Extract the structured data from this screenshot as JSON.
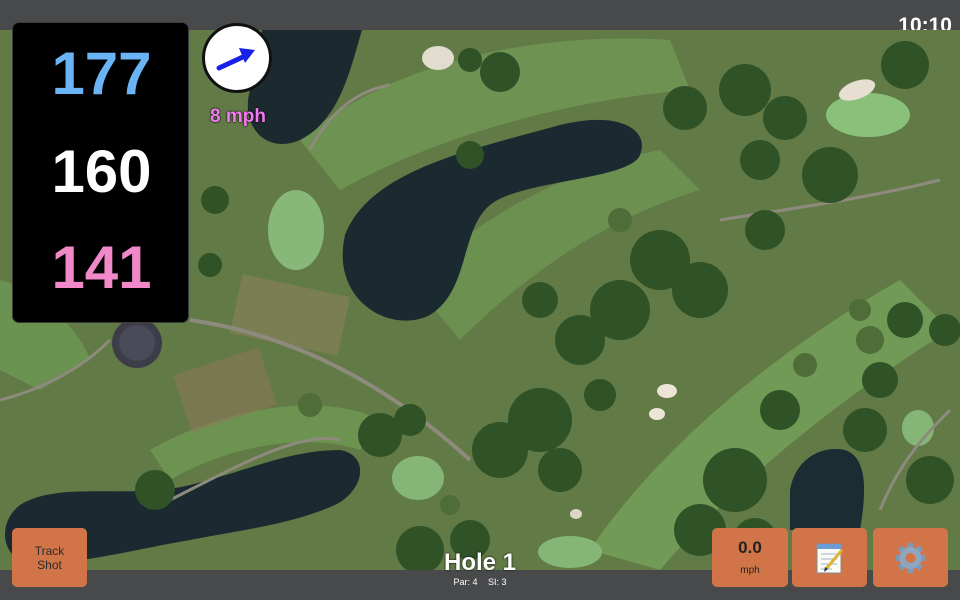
{
  "status_bar": {
    "time": "10:10"
  },
  "distances": {
    "back": "177",
    "middle": "160",
    "front": "141",
    "colors": {
      "back": "#6ab4f5",
      "middle": "#ffffff",
      "front": "#f189c9"
    }
  },
  "wind": {
    "speed_label": "8 mph",
    "arrow_icon": "wind-direction-arrow-icon",
    "arrow_color": "#1a21e6"
  },
  "buttons": {
    "track_shot": "Track\nShot",
    "speed_value": "0.0",
    "speed_unit": "mph",
    "notes_icon": "notepad-icon",
    "settings_icon": "gear-icon",
    "button_color": "#d17548"
  },
  "hole": {
    "title": "Hole 1",
    "par": "Par: 4",
    "stroke_index": "SI: 3"
  }
}
